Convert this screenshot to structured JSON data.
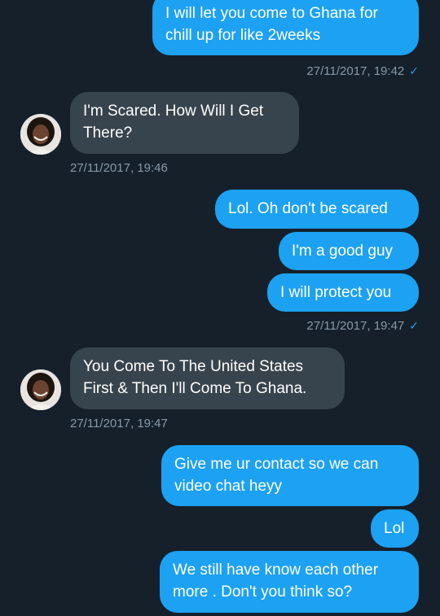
{
  "messages": [
    {
      "id": "m1",
      "side": "out",
      "lines": [
        "I will let you come to Ghana for",
        "chill up for like 2weeks"
      ]
    },
    {
      "id": "m2",
      "side": "in",
      "lines": [
        "I'm Scared. How Will I Get",
        "There?"
      ]
    },
    {
      "id": "m3",
      "side": "out",
      "lines": [
        "Lol. Oh don't be scared"
      ]
    },
    {
      "id": "m4",
      "side": "out",
      "lines": [
        "I'm a good guy"
      ]
    },
    {
      "id": "m5",
      "side": "out",
      "lines": [
        "I will protect you"
      ]
    },
    {
      "id": "m6",
      "side": "in",
      "lines": [
        "You Come To The United States",
        "First & Then I'll Come To Ghana."
      ]
    },
    {
      "id": "m7",
      "side": "out",
      "lines": [
        "Give me ur contact so we can",
        "video chat heyy"
      ]
    },
    {
      "id": "m8",
      "side": "out",
      "lines": [
        "Lol"
      ]
    },
    {
      "id": "m9",
      "side": "out",
      "lines": [
        "We still have know each other",
        "more . Don't you think so?"
      ]
    }
  ],
  "timestamps": {
    "t1": "27/11/2017, 19:42",
    "t2": "27/11/2017, 19:46",
    "t3": "27/11/2017, 19:47",
    "t4": "27/11/2017, 19:47"
  },
  "read_receipt_icon": "check-icon",
  "read_receipt_glyph": "✓",
  "colors": {
    "background": "#15202b",
    "outgoing_bubble": "#1da1f2",
    "incoming_bubble": "#38444d",
    "timestamp": "#8899a6"
  }
}
